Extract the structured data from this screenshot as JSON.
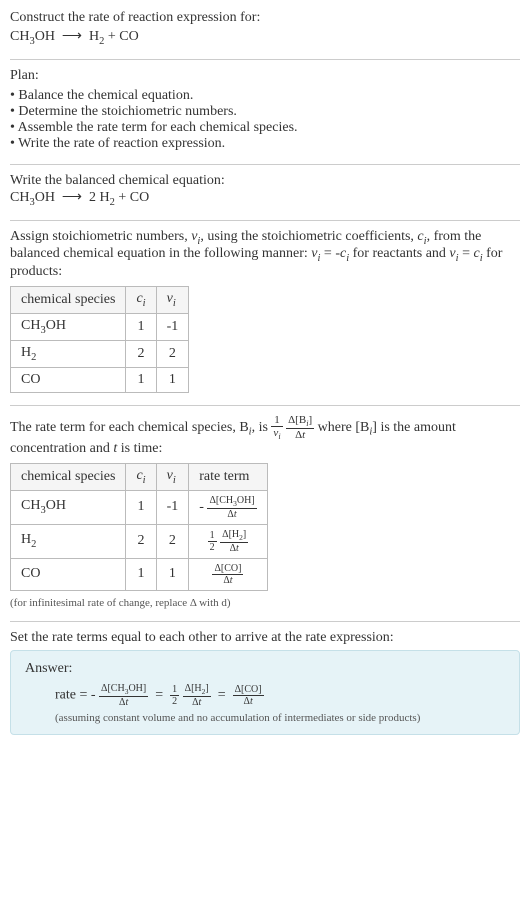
{
  "intro": {
    "line1": "Construct the rate of reaction expression for:",
    "eq": "CH₃OH ⟶ H₂ + CO"
  },
  "plan": {
    "title": "Plan:",
    "items": [
      "Balance the chemical equation.",
      "Determine the stoichiometric numbers.",
      "Assemble the rate term for each chemical species.",
      "Write the rate of reaction expression."
    ]
  },
  "balanced": {
    "title": "Write the balanced chemical equation:",
    "eq": "CH₃OH ⟶ 2 H₂ + CO"
  },
  "stoich_text": {
    "p1a": "Assign stoichiometric numbers, ",
    "p1b": ", using the stoichiometric coefficients, ",
    "p1c": ", from the balanced chemical equation in the following manner: ",
    "p1d": " for reactants and ",
    "p1e": " for products:"
  },
  "stoich_table": {
    "headers": [
      "chemical species",
      "cᵢ",
      "νᵢ"
    ],
    "rows": [
      [
        "CH₃OH",
        "1",
        "-1"
      ],
      [
        "H₂",
        "2",
        "2"
      ],
      [
        "CO",
        "1",
        "1"
      ]
    ]
  },
  "rate_term_text": {
    "a": "The rate term for each chemical species, B",
    "b": ", is ",
    "c": " where [B",
    "d": "] is the amount concentration and ",
    "e": " is time:"
  },
  "rate_table": {
    "headers": [
      "chemical species",
      "cᵢ",
      "νᵢ",
      "rate term"
    ],
    "rows": [
      {
        "species": "CH₃OH",
        "c": "1",
        "nu": "-1",
        "rate": "-Δ[CH₃OH]/Δt"
      },
      {
        "species": "H₂",
        "c": "2",
        "nu": "2",
        "rate": "½ Δ[H₂]/Δt"
      },
      {
        "species": "CO",
        "c": "1",
        "nu": "1",
        "rate": "Δ[CO]/Δt"
      }
    ],
    "note": "(for infinitesimal rate of change, replace Δ with d)"
  },
  "final": {
    "intro": "Set the rate terms equal to each other to arrive at the rate expression:",
    "answer_label": "Answer:",
    "rate_prefix": "rate = ",
    "note": "(assuming constant volume and no accumulation of intermediates or side products)"
  }
}
